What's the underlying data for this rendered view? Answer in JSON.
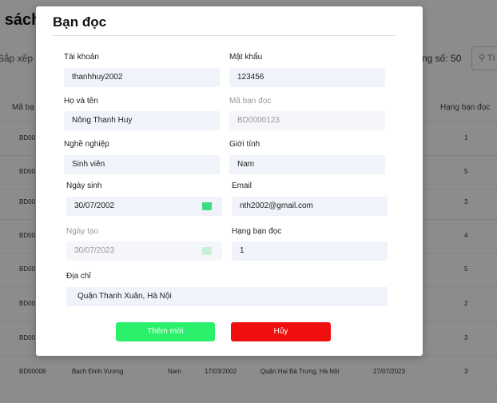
{
  "background": {
    "page_title": "n sách",
    "sort_label": "Sắp xếp",
    "total_label": "ng số: 50",
    "search_placeholder": "Tì",
    "search_icon": "search-icon",
    "columns": {
      "first": "Mã bạ",
      "last": "Hạng bạn đọc"
    },
    "rows": [
      {
        "id": "BD00",
        "rank": "1"
      },
      {
        "id": "BD00",
        "rank": "5"
      },
      {
        "id": "BD00",
        "rank": "3"
      },
      {
        "id": "BD00",
        "rank": "4"
      },
      {
        "id": "BD00",
        "rank": "5"
      },
      {
        "id": "BD00",
        "rank": "2"
      },
      {
        "id": "BD00",
        "rank": "3"
      }
    ],
    "last_row": {
      "id": "BD00008",
      "name": "Bạch Đình Vương",
      "gender": "Nam",
      "birth": "17/03/2002",
      "address": "Quận Hai Bà Trưng, Hà Nội",
      "created": "27/07/2023",
      "rank": "3"
    }
  },
  "modal": {
    "title": "Bạn đọc",
    "fields": {
      "account": {
        "label": "Tài khoản",
        "value": "thanhhuy2002"
      },
      "password": {
        "label": "Mật khẩu",
        "value": "123456"
      },
      "fullname": {
        "label": "Họ và tên",
        "value": "Nông Thanh Huy"
      },
      "reader_code": {
        "label": "Mã bạn đọc",
        "value": "BD0000123"
      },
      "occupation": {
        "label": "Nghề nghiệp",
        "value": "Sinh viên"
      },
      "gender": {
        "label": "Giới tính",
        "value": "Nam"
      },
      "birthdate": {
        "label": "Ngày sinh",
        "value": "30/07/2002"
      },
      "email": {
        "label": "Email",
        "value": "nth2002@gmail.com"
      },
      "created_date": {
        "label": "Ngày tạo",
        "value": "30/07/2023"
      },
      "rank": {
        "label": "Hạng bạn đọc",
        "value": "1"
      },
      "address": {
        "label": "Địa chỉ",
        "value": "Quận Thanh Xuân, Hà Nội"
      }
    },
    "add_button": "Thêm mới",
    "cancel_button": "Hủy"
  },
  "colors": {
    "add_button": "#2bf06b",
    "cancel_button": "#f00f0f",
    "calendar_icon_active": "#3ddc84",
    "calendar_icon_disabled": "#c8f0d6"
  }
}
